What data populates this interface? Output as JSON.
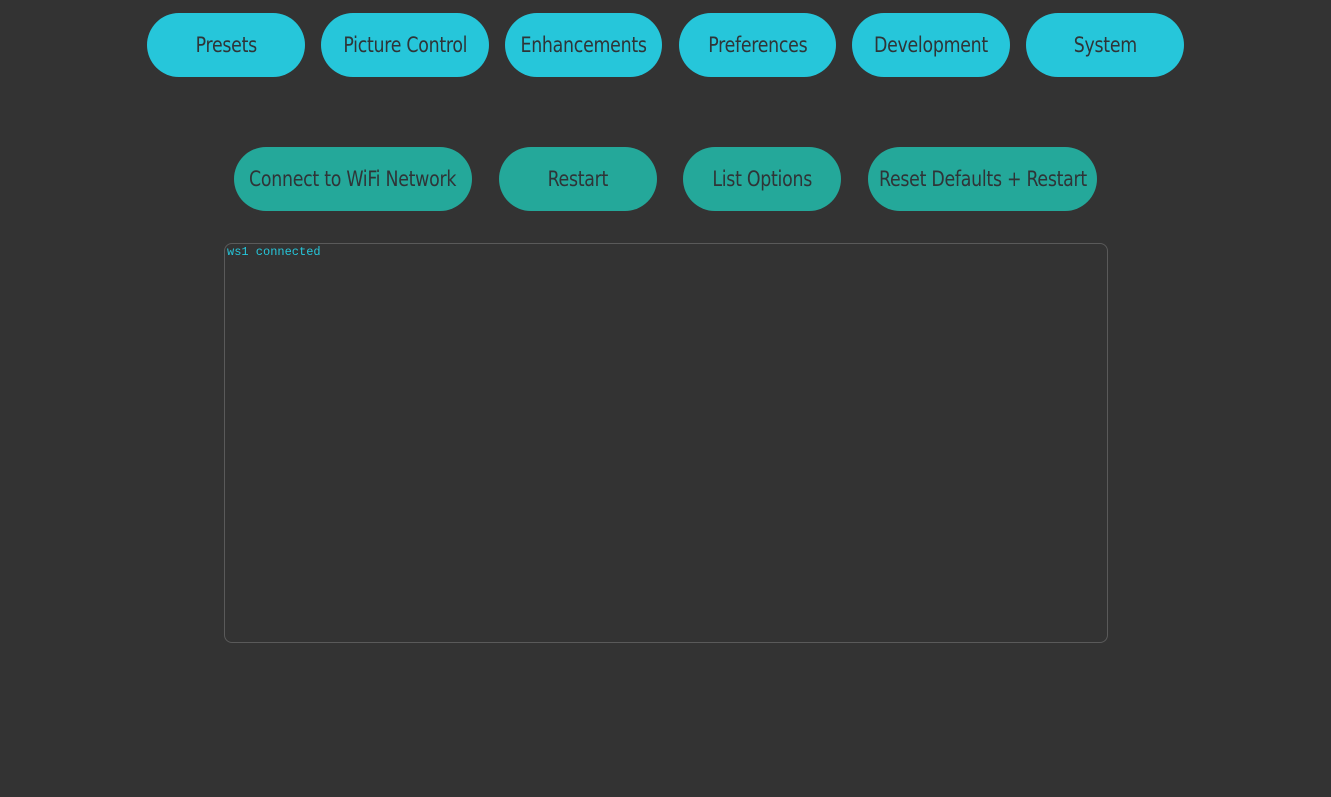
{
  "nav": {
    "presets": "Presets",
    "picture_control": "Picture Control",
    "enhancements": "Enhancements",
    "preferences": "Preferences",
    "development": "Development",
    "system": "System"
  },
  "actions": {
    "connect_wifi": "Connect to WiFi Network",
    "restart": "Restart",
    "list_options": "List Options",
    "reset_defaults": "Reset Defaults + Restart"
  },
  "console": {
    "lines": [
      "ws1 connected"
    ]
  },
  "colors": {
    "background": "#333333",
    "nav_button": "#26c6da",
    "action_button": "#24a89a",
    "button_text": "#2f3437",
    "console_text": "#26c6da",
    "console_border": "#5a5a5a"
  }
}
